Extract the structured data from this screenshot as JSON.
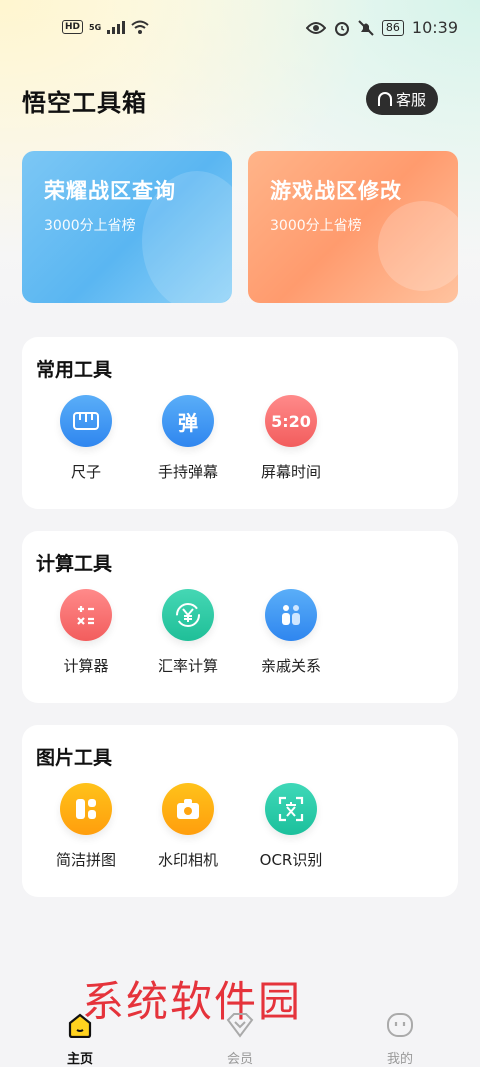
{
  "status_bar": {
    "network": "5G",
    "hd": "HD",
    "battery": "86",
    "time": "10:39"
  },
  "header": {
    "title": "悟空工具箱",
    "service_label": "客服"
  },
  "banners": [
    {
      "title": "荣耀战区查询",
      "subtitle": "3000分上省榜"
    },
    {
      "title": "游戏战区修改",
      "subtitle": "3000分上省榜"
    }
  ],
  "sections": [
    {
      "title": "常用工具",
      "tools": [
        {
          "label": "尺子",
          "icon": "ruler-icon"
        },
        {
          "label": "手持弹幕",
          "icon": "danmu-icon",
          "glyph": "弹"
        },
        {
          "label": "屏幕时间",
          "icon": "screen-time-icon",
          "glyph": "5:20"
        }
      ]
    },
    {
      "title": "计算工具",
      "tools": [
        {
          "label": "计算器",
          "icon": "calculator-icon"
        },
        {
          "label": "汇率计算",
          "icon": "exchange-rate-icon"
        },
        {
          "label": "亲戚关系",
          "icon": "relatives-icon"
        }
      ]
    },
    {
      "title": "图片工具",
      "tools": [
        {
          "label": "简洁拼图",
          "icon": "collage-icon"
        },
        {
          "label": "水印相机",
          "icon": "watermark-camera-icon"
        },
        {
          "label": "OCR识别",
          "icon": "ocr-icon"
        }
      ]
    }
  ],
  "watermark": "系统软件园",
  "tabbar": [
    {
      "label": "主页",
      "icon": "home-icon",
      "active": true
    },
    {
      "label": "会员",
      "icon": "vip-icon",
      "active": false
    },
    {
      "label": "我的",
      "icon": "profile-icon",
      "active": false
    }
  ]
}
